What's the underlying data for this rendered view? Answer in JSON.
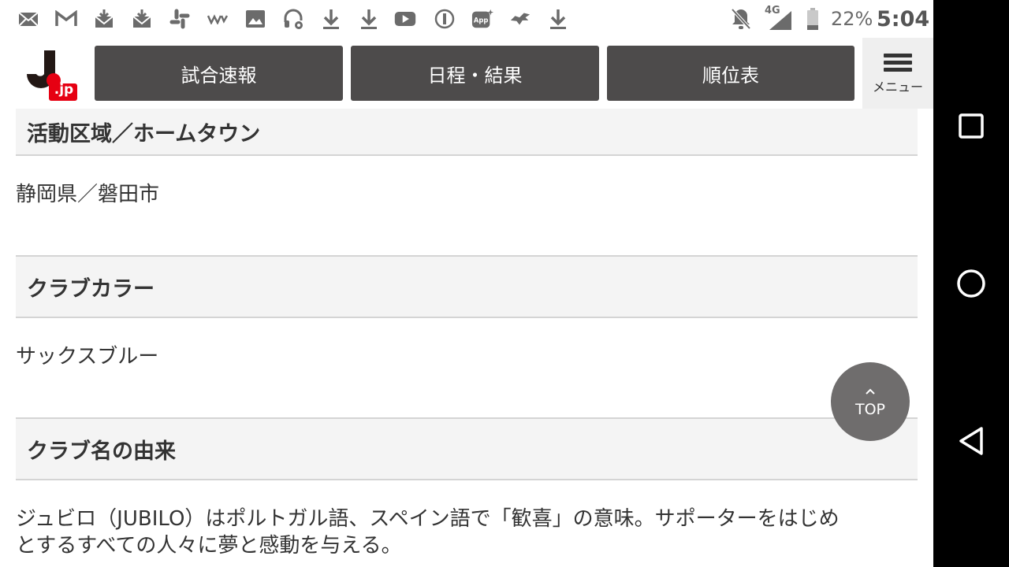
{
  "status_bar": {
    "notification_icons": [
      "gmail-inbox-icon",
      "gmail-icon",
      "download-mail-icon",
      "mail-download-icon",
      "slack-icon",
      "w-app-icon",
      "image-icon",
      "headset-settings-icon",
      "download-icon",
      "download-icon",
      "youtube-icon",
      "info-circle-icon",
      "app-icon",
      "dragon-icon",
      "download-icon"
    ],
    "network": "4G",
    "battery": "22%",
    "time": "5:04"
  },
  "header": {
    "logo_text": ".jp",
    "nav": [
      {
        "label": "試合速報"
      },
      {
        "label": "日程・結果"
      },
      {
        "label": "順位表"
      }
    ],
    "menu_label": "メニュー"
  },
  "content": {
    "sections": [
      {
        "heading": "活動区域／ホームタウン",
        "body": "静岡県／磐田市"
      },
      {
        "heading": "クラブカラー",
        "body": "サックスブルー"
      },
      {
        "heading": "クラブ名の由来",
        "body_line1": "ジュビロ（JUBILO）はポルトガル語、スペイン語で「歓喜」の意味。サポーターをはじめ",
        "body_line2": "とするすべての人々に夢と感動を与える。"
      }
    ]
  },
  "top_button": {
    "label": "TOP"
  },
  "colors": {
    "nav_button": "#4d4b4b",
    "logo_red": "#e60012",
    "section_bg": "#f4f4f4"
  }
}
